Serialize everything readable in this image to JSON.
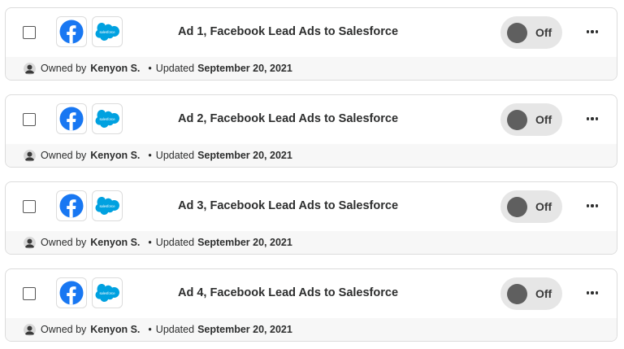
{
  "zaps": [
    {
      "title": "Ad 1, Facebook Lead Ads to Salesforce",
      "status": "Off",
      "owned_by_label": "Owned by",
      "owner": "Kenyon S.",
      "updated_label": "Updated",
      "updated_date": "September 20, 2021"
    },
    {
      "title": "Ad 2, Facebook Lead Ads to Salesforce",
      "status": "Off",
      "owned_by_label": "Owned by",
      "owner": "Kenyon S.",
      "updated_label": "Updated",
      "updated_date": "September 20, 2021"
    },
    {
      "title": "Ad 3, Facebook Lead Ads to Salesforce",
      "status": "Off",
      "owned_by_label": "Owned by",
      "owner": "Kenyon S.",
      "updated_label": "Updated",
      "updated_date": "September 20, 2021"
    },
    {
      "title": "Ad 4, Facebook Lead Ads to Salesforce",
      "status": "Off",
      "owned_by_label": "Owned by",
      "owner": "Kenyon S.",
      "updated_label": "Updated",
      "updated_date": "September 20, 2021"
    }
  ],
  "apps": {
    "facebook_icon": "facebook-icon",
    "salesforce_icon": "salesforce-icon",
    "salesforce_text": "salesforce"
  },
  "separator": "•",
  "colors": {
    "facebook": "#1877f2",
    "salesforce": "#00a1e0",
    "toggle_off_track": "#e6e6e6",
    "toggle_off_knob": "#5f5f5f"
  }
}
